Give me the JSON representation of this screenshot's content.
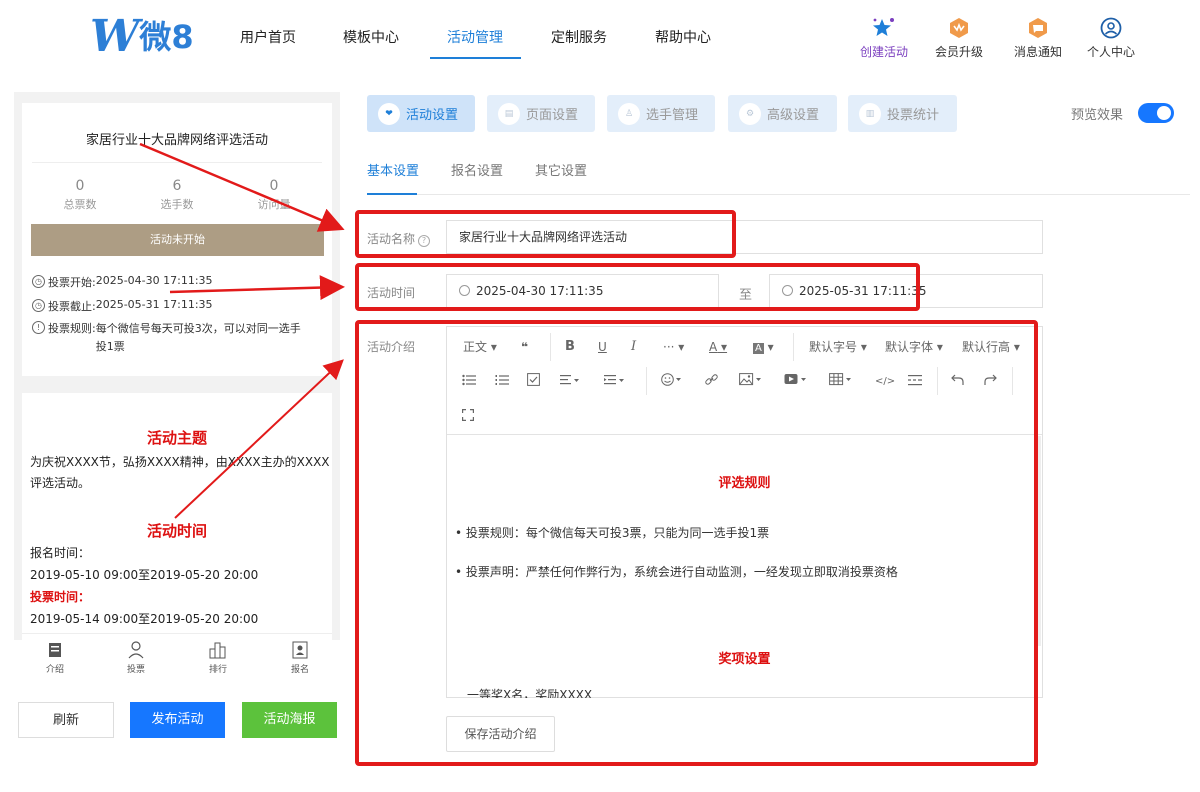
{
  "logo": {
    "mark": "W",
    "text": "微8"
  },
  "nav": {
    "items": [
      {
        "label": "用户首页"
      },
      {
        "label": "模板中心"
      },
      {
        "label": "活动管理"
      },
      {
        "label": "定制服务"
      },
      {
        "label": "帮助中心"
      }
    ],
    "active_index": 2,
    "tools": [
      {
        "label": "创建活动",
        "icon": "star-sparkle-icon"
      },
      {
        "label": "会员升级",
        "icon": "vip-badge-icon"
      },
      {
        "label": "消息通知",
        "icon": "message-badge-icon"
      },
      {
        "label": "个人中心",
        "icon": "user-circle-icon"
      }
    ]
  },
  "preview": {
    "title": "家居行业十大品牌网络评选活动",
    "stats": [
      {
        "value": "0",
        "label": "总票数"
      },
      {
        "value": "6",
        "label": "选手数"
      },
      {
        "value": "0",
        "label": "访问量"
      }
    ],
    "status": "活动未开始",
    "vote_start_label": "投票开始:",
    "vote_start": "2025-04-30 17:11:35",
    "vote_end_label": "投票截止:",
    "vote_end": "2025-05-31 17:11:35",
    "rule_label": "投票规则:",
    "rule": "每个微信号每天可投3次，可以对同一选手投1票",
    "theme_heading": "活动主题",
    "theme_text": "为庆祝XXXX节，弘扬XXXX精神，由XXXX主办的XXXX评选活动。",
    "time_heading": "活动时间",
    "signup_label": "报名时间：",
    "signup_range": "2019-05-10 09:00至2019-05-20 20:00",
    "vote_label": "投票时间：",
    "vote_range": "2019-05-14 09:00至2019-05-20 20:00",
    "tabs": [
      {
        "label": "介绍",
        "icon": "doc-icon"
      },
      {
        "label": "投票",
        "icon": "user-icon"
      },
      {
        "label": "排行",
        "icon": "rank-icon"
      },
      {
        "label": "报名",
        "icon": "signup-icon"
      }
    ]
  },
  "left_buttons": {
    "refresh": "刷新",
    "publish": "发布活动",
    "poster": "活动海报"
  },
  "main_tabs": [
    {
      "label": "活动设置",
      "icon": "heart-icon"
    },
    {
      "label": "页面设置",
      "icon": "page-icon"
    },
    {
      "label": "选手管理",
      "icon": "player-icon"
    },
    {
      "label": "高级设置",
      "icon": "advanced-icon"
    },
    {
      "label": "投票统计",
      "icon": "stats-icon"
    }
  ],
  "preview_toggle": {
    "label": "预览效果",
    "on": true
  },
  "sub_tabs": [
    {
      "label": "基本设置"
    },
    {
      "label": "报名设置"
    },
    {
      "label": "其它设置"
    }
  ],
  "form": {
    "name_label": "活动名称",
    "name_value": "家居行业十大品牌网络评选活动",
    "time_label": "活动时间",
    "start_value": "2025-04-30 17:11:35",
    "to": "至",
    "end_value": "2025-05-31 17:11:35",
    "intro_label": "活动介绍"
  },
  "editor": {
    "toolbar_row1": [
      "正文",
      "❝",
      "B",
      "U",
      "I",
      "···",
      "A",
      "A",
      "默认字号",
      "默认字体",
      "默认行高"
    ],
    "heading1": "评选规则",
    "bullet1": "• 投票规则：每个微信每天可投3票，只能为同一选手投1票",
    "bullet2": "• 投票声明：严禁任何作弊行为，系统会进行自动监测，一经发现立即取消投票资格",
    "heading2": "奖项设置",
    "cut_text": "一等奖X名，奖励XXXX"
  },
  "save_intro": "保存活动介绍",
  "colors": {
    "accent": "#1e7fd8",
    "annotation": "#e21a1a",
    "publish": "#1677ff",
    "poster": "#5cc23c",
    "status": "#ad9d84"
  }
}
